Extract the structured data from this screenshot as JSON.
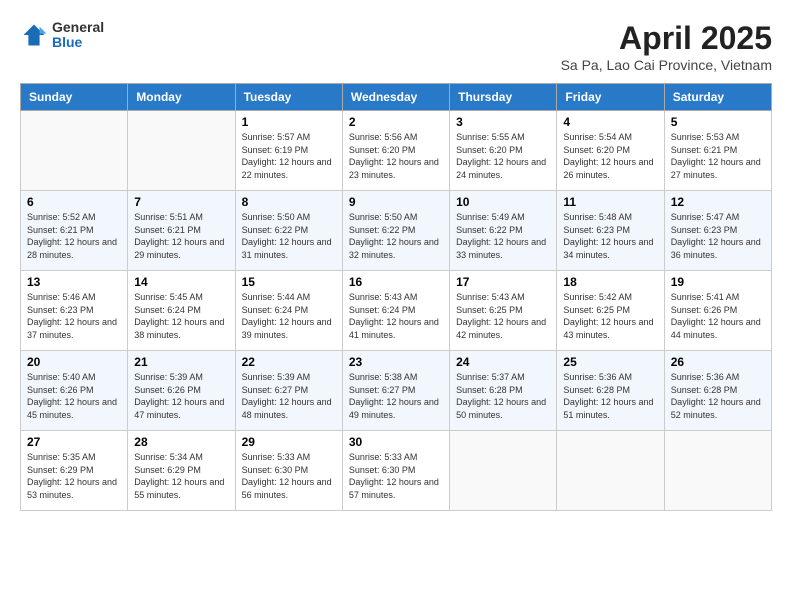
{
  "logo": {
    "line1": "General",
    "line2": "Blue"
  },
  "title": "April 2025",
  "subtitle": "Sa Pa, Lao Cai Province, Vietnam",
  "days_of_week": [
    "Sunday",
    "Monday",
    "Tuesday",
    "Wednesday",
    "Thursday",
    "Friday",
    "Saturday"
  ],
  "weeks": [
    [
      {
        "day": "",
        "detail": ""
      },
      {
        "day": "",
        "detail": ""
      },
      {
        "day": "1",
        "detail": "Sunrise: 5:57 AM\nSunset: 6:19 PM\nDaylight: 12 hours and 22 minutes."
      },
      {
        "day": "2",
        "detail": "Sunrise: 5:56 AM\nSunset: 6:20 PM\nDaylight: 12 hours and 23 minutes."
      },
      {
        "day": "3",
        "detail": "Sunrise: 5:55 AM\nSunset: 6:20 PM\nDaylight: 12 hours and 24 minutes."
      },
      {
        "day": "4",
        "detail": "Sunrise: 5:54 AM\nSunset: 6:20 PM\nDaylight: 12 hours and 26 minutes."
      },
      {
        "day": "5",
        "detail": "Sunrise: 5:53 AM\nSunset: 6:21 PM\nDaylight: 12 hours and 27 minutes."
      }
    ],
    [
      {
        "day": "6",
        "detail": "Sunrise: 5:52 AM\nSunset: 6:21 PM\nDaylight: 12 hours and 28 minutes."
      },
      {
        "day": "7",
        "detail": "Sunrise: 5:51 AM\nSunset: 6:21 PM\nDaylight: 12 hours and 29 minutes."
      },
      {
        "day": "8",
        "detail": "Sunrise: 5:50 AM\nSunset: 6:22 PM\nDaylight: 12 hours and 31 minutes."
      },
      {
        "day": "9",
        "detail": "Sunrise: 5:50 AM\nSunset: 6:22 PM\nDaylight: 12 hours and 32 minutes."
      },
      {
        "day": "10",
        "detail": "Sunrise: 5:49 AM\nSunset: 6:22 PM\nDaylight: 12 hours and 33 minutes."
      },
      {
        "day": "11",
        "detail": "Sunrise: 5:48 AM\nSunset: 6:23 PM\nDaylight: 12 hours and 34 minutes."
      },
      {
        "day": "12",
        "detail": "Sunrise: 5:47 AM\nSunset: 6:23 PM\nDaylight: 12 hours and 36 minutes."
      }
    ],
    [
      {
        "day": "13",
        "detail": "Sunrise: 5:46 AM\nSunset: 6:23 PM\nDaylight: 12 hours and 37 minutes."
      },
      {
        "day": "14",
        "detail": "Sunrise: 5:45 AM\nSunset: 6:24 PM\nDaylight: 12 hours and 38 minutes."
      },
      {
        "day": "15",
        "detail": "Sunrise: 5:44 AM\nSunset: 6:24 PM\nDaylight: 12 hours and 39 minutes."
      },
      {
        "day": "16",
        "detail": "Sunrise: 5:43 AM\nSunset: 6:24 PM\nDaylight: 12 hours and 41 minutes."
      },
      {
        "day": "17",
        "detail": "Sunrise: 5:43 AM\nSunset: 6:25 PM\nDaylight: 12 hours and 42 minutes."
      },
      {
        "day": "18",
        "detail": "Sunrise: 5:42 AM\nSunset: 6:25 PM\nDaylight: 12 hours and 43 minutes."
      },
      {
        "day": "19",
        "detail": "Sunrise: 5:41 AM\nSunset: 6:26 PM\nDaylight: 12 hours and 44 minutes."
      }
    ],
    [
      {
        "day": "20",
        "detail": "Sunrise: 5:40 AM\nSunset: 6:26 PM\nDaylight: 12 hours and 45 minutes."
      },
      {
        "day": "21",
        "detail": "Sunrise: 5:39 AM\nSunset: 6:26 PM\nDaylight: 12 hours and 47 minutes."
      },
      {
        "day": "22",
        "detail": "Sunrise: 5:39 AM\nSunset: 6:27 PM\nDaylight: 12 hours and 48 minutes."
      },
      {
        "day": "23",
        "detail": "Sunrise: 5:38 AM\nSunset: 6:27 PM\nDaylight: 12 hours and 49 minutes."
      },
      {
        "day": "24",
        "detail": "Sunrise: 5:37 AM\nSunset: 6:28 PM\nDaylight: 12 hours and 50 minutes."
      },
      {
        "day": "25",
        "detail": "Sunrise: 5:36 AM\nSunset: 6:28 PM\nDaylight: 12 hours and 51 minutes."
      },
      {
        "day": "26",
        "detail": "Sunrise: 5:36 AM\nSunset: 6:28 PM\nDaylight: 12 hours and 52 minutes."
      }
    ],
    [
      {
        "day": "27",
        "detail": "Sunrise: 5:35 AM\nSunset: 6:29 PM\nDaylight: 12 hours and 53 minutes."
      },
      {
        "day": "28",
        "detail": "Sunrise: 5:34 AM\nSunset: 6:29 PM\nDaylight: 12 hours and 55 minutes."
      },
      {
        "day": "29",
        "detail": "Sunrise: 5:33 AM\nSunset: 6:30 PM\nDaylight: 12 hours and 56 minutes."
      },
      {
        "day": "30",
        "detail": "Sunrise: 5:33 AM\nSunset: 6:30 PM\nDaylight: 12 hours and 57 minutes."
      },
      {
        "day": "",
        "detail": ""
      },
      {
        "day": "",
        "detail": ""
      },
      {
        "day": "",
        "detail": ""
      }
    ]
  ]
}
